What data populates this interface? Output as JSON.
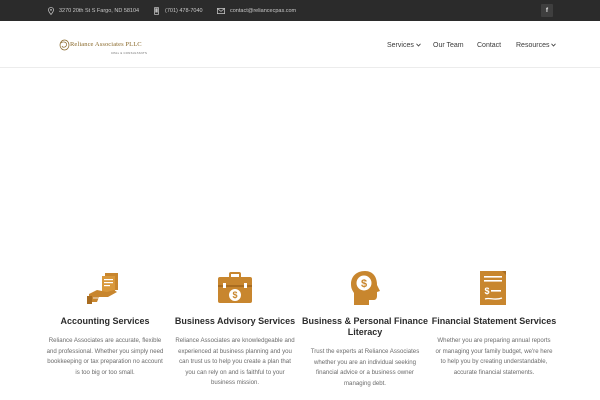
{
  "topbar": {
    "address": "3270 20th St S Fargo, ND 58104",
    "phone": "(701) 478-7040",
    "email": "contact@reliancecpas.com",
    "facebook_label": "f",
    "icons": [
      "map-pin-icon",
      "phone-icon",
      "envelope-icon",
      "facebook-icon"
    ]
  },
  "logo": {
    "name": "Reliance Associates PLLC",
    "tagline": "CPAs & CONSULTANTS"
  },
  "nav": {
    "services": "Services",
    "team": "Our Team",
    "contact": "Contact",
    "resources": "Resources"
  },
  "services": [
    {
      "title": "Accounting Services",
      "description": "Reliance Associates are accurate, flexible and professional. Whether you simply need bookkeeping or tax preparation no account is too big or too small.",
      "icon": "hand-documents-icon"
    },
    {
      "title": "Business Advisory Services",
      "description": "Reliance Associates are knowledgeable and experienced at business planning and you can trust us to help you create a plan that you can rely on and is faithful to your business mission.",
      "icon": "briefcase-dollar-icon"
    },
    {
      "title": "Business & Personal Finance Literacy",
      "description": "Trust the experts at Reliance Associates whether you are an individual seeking financial advice or a business owner managing debt.",
      "icon": "head-dollar-icon"
    },
    {
      "title": "Financial Statement Services",
      "description": "Whether you are preparing annual reports or managing your family budget, we're here to help you by creating understandable, accurate financial statements.",
      "icon": "document-dollar-icon"
    }
  ],
  "colors": {
    "topbar_bg": "#2b2b2b",
    "accent_gold": "#c8862e",
    "text_dark": "#2c2c2c",
    "text_muted": "#6b6b6b"
  }
}
